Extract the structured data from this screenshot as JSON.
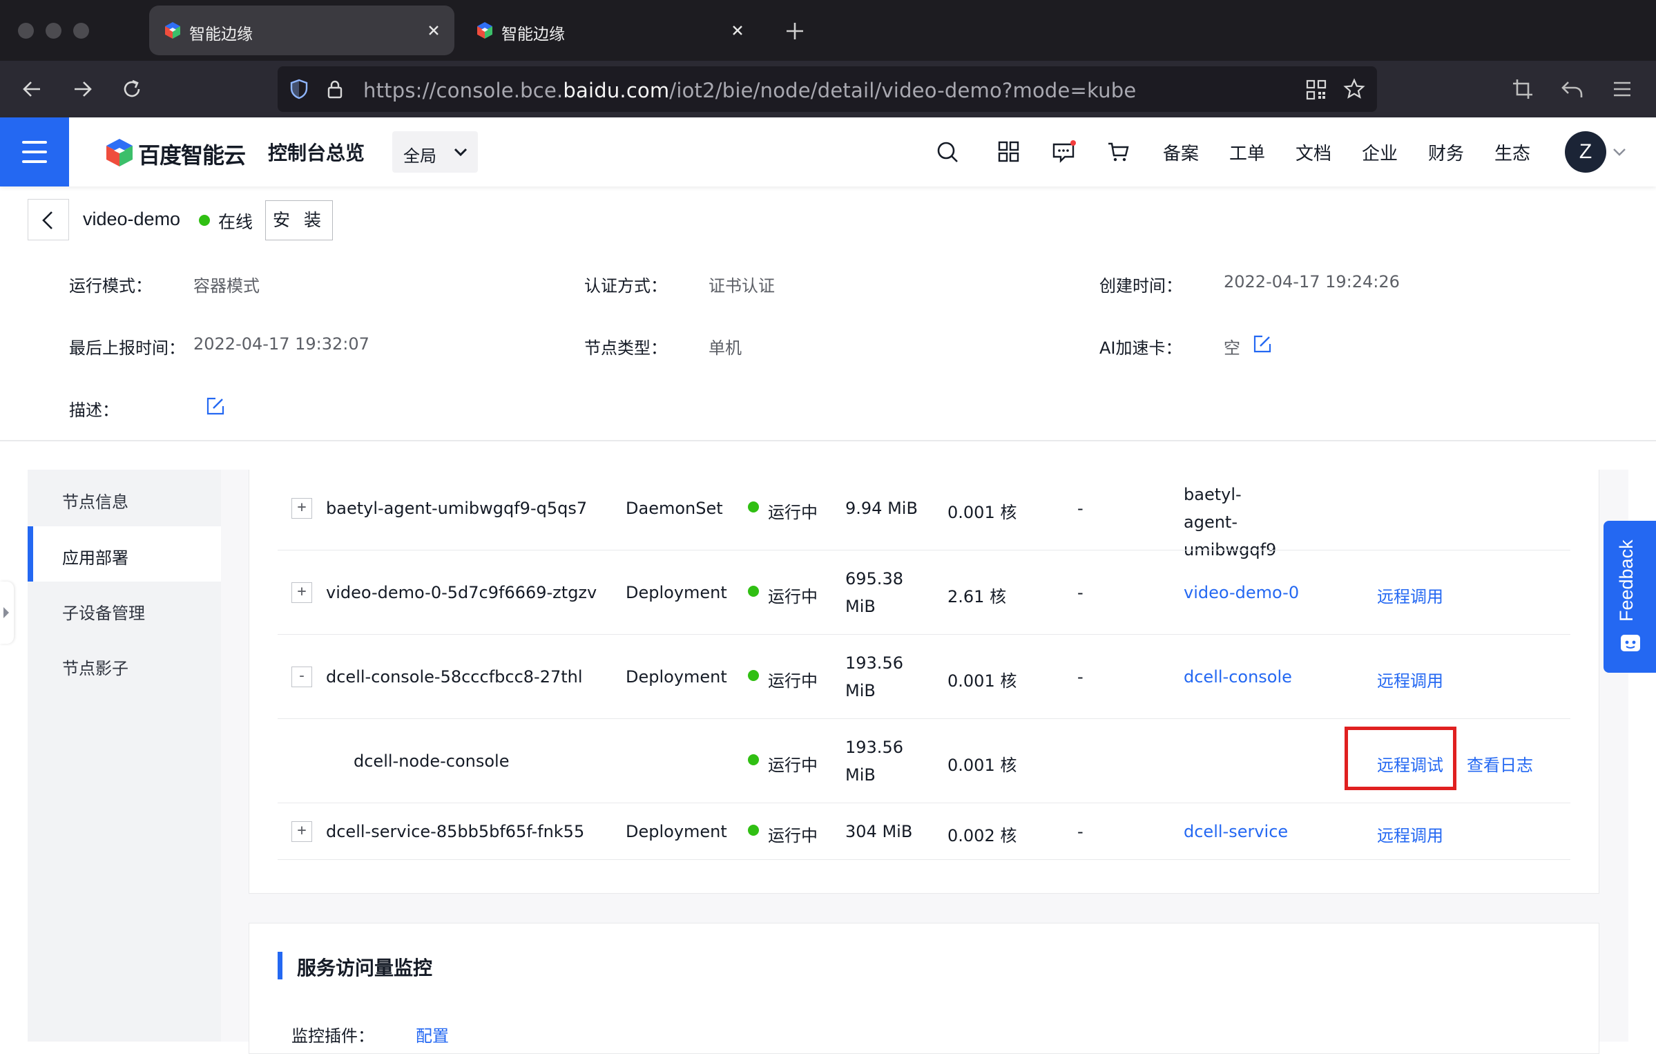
{
  "browser": {
    "tabs": [
      {
        "title": "智能边缘",
        "active": true
      },
      {
        "title": "智能边缘",
        "active": false
      }
    ],
    "url": {
      "prefix": "https://console.bce.",
      "domain": "baidu.com",
      "path": "/iot2/bie/node/detail/video-demo?mode=kube"
    }
  },
  "header": {
    "brand": "百度智能云",
    "console_title": "控制台总览",
    "region": "全局",
    "links": [
      "备案",
      "工单",
      "文档",
      "企业",
      "财务",
      "生态"
    ],
    "avatar": "Z"
  },
  "node": {
    "name": "video-demo",
    "status": "在线",
    "install_label": "安 装"
  },
  "info": {
    "run_mode_label": "运行模式：",
    "run_mode": "容器模式",
    "auth_label": "认证方式：",
    "auth": "证书认证",
    "created_label": "创建时间：",
    "created": "2022-04-17 19:24:26",
    "last_report_label": "最后上报时间：",
    "last_report": "2022-04-17 19:32:07",
    "node_type_label": "节点类型：",
    "node_type": "单机",
    "ai_card_label": "AI加速卡：",
    "ai_card": "空",
    "desc_label": "描述："
  },
  "sidebar": {
    "items": [
      {
        "label": "节点信息",
        "active": false
      },
      {
        "label": "应用部署",
        "active": true
      },
      {
        "label": "子设备管理",
        "active": false
      },
      {
        "label": "节点影子",
        "active": false
      }
    ]
  },
  "table": {
    "rows": [
      {
        "expand": "+",
        "name": "baetyl-agent-umibwgqf9-q5qs7",
        "kind": "DaemonSet",
        "status": "运行中",
        "memory": "9.94 MiB",
        "cpu": "0.001 核",
        "dash": "-",
        "app": "baetyl-agent-umibwgqf9",
        "action1": "",
        "action2": ""
      },
      {
        "expand": "+",
        "name": "video-demo-0-5d7c9f6669-ztgzv",
        "kind": "Deployment",
        "status": "运行中",
        "memory": "695.38 MiB",
        "cpu": "2.61 核",
        "dash": "-",
        "app": "video-demo-0",
        "action1": "远程调用",
        "action2": ""
      },
      {
        "expand": "-",
        "name": "dcell-console-58cccfbcc8-27thl",
        "kind": "Deployment",
        "status": "运行中",
        "memory": "193.56 MiB",
        "cpu": "0.001 核",
        "dash": "-",
        "app": "dcell-console",
        "action1": "远程调用",
        "action2": ""
      },
      {
        "expand": "",
        "name": "dcell-node-console",
        "kind": "",
        "status": "运行中",
        "memory": "193.56 MiB",
        "cpu": "0.001 核",
        "dash": "",
        "app": "",
        "action1": "远程调试",
        "action2": "查看日志"
      },
      {
        "expand": "+",
        "name": "dcell-service-85bb5bf65f-fnk55",
        "kind": "Deployment",
        "status": "运行中",
        "memory": "304 MiB",
        "cpu": "0.002 核",
        "dash": "-",
        "app": "dcell-service",
        "action1": "远程调用",
        "action2": ""
      }
    ]
  },
  "monitor": {
    "title": "服务访问量监控",
    "plugin_label": "监控插件：",
    "plugin_link": "配置"
  },
  "feedback": "Feedback",
  "colors": {
    "accent": "#2468f2",
    "online": "#30bf13",
    "highlight": "#e02020"
  }
}
